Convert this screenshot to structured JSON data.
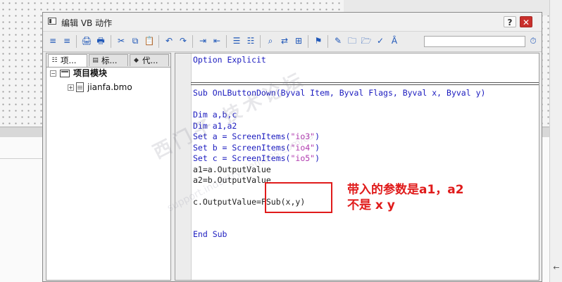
{
  "window": {
    "title": "编辑 VB 动作",
    "help_label": "?",
    "close_label": "✕"
  },
  "toolbar": {
    "icons": [
      "align-left-icon",
      "align-right-icon",
      "print-icon",
      "print-preview-icon",
      "cut-icon",
      "copy-icon",
      "paste-icon",
      "undo-icon",
      "redo-icon",
      "indent-icon",
      "outdent-icon",
      "comment-icon",
      "uncomment-icon",
      "find-icon",
      "replace-icon",
      "bookmark-icon",
      "syntax-check-icon",
      "new-item-icon",
      "folder-icon",
      "folder-add-icon",
      "tag-icon",
      "compile-icon",
      "clock-icon"
    ],
    "glyphs": [
      "≡",
      "≡",
      "🖨",
      "🖶",
      "✂",
      "⧉",
      "📋",
      "↶",
      "↷",
      "⇥",
      "⇤",
      "☰",
      "☷",
      "⌕",
      "⇄",
      "⊞",
      "⚑",
      "✎",
      "🗀",
      "🗁",
      "✓",
      "Ȃ",
      "⏱"
    ]
  },
  "left_panel": {
    "tabs": [
      {
        "label": "项...",
        "icon": "tree-icon"
      },
      {
        "label": "标...",
        "icon": "tag-icon"
      },
      {
        "label": "代...",
        "icon": "code-icon"
      }
    ],
    "tree": {
      "root_label": "项目模块",
      "root_expander": "−",
      "child_label": "jianfa.bmo",
      "child_expander": "+"
    }
  },
  "editor": {
    "lines": [
      "Option Explicit",
      "Sub OnLButtonDown(Byval Item, Byval Flags, Byval x, Byval y)",
      "Dim a,b,c",
      "Dim a1,a2",
      "Set a = ScreenItems(\"io3\")",
      "Set b = ScreenItems(\"io4\")",
      "Set c = ScreenItems(\"io5\")",
      "a1=a.OutputValue",
      "a2=b.OutputValue",
      "c.OutputValue=FSub(x,y)",
      "End Sub"
    ],
    "string_parts": {
      "l4_pre": "Set a = ScreenItems(",
      "l4_str": "\"io3\"",
      "l4_post": ")",
      "l5_pre": "Set b = ScreenItems(",
      "l5_str": "\"io4\"",
      "l5_post": ")",
      "l6_pre": "Set c = ScreenItems(",
      "l6_str": "\"io5\"",
      "l6_post": ")"
    }
  },
  "annotation": {
    "line1": "带入的参数是a1，a2",
    "line2": "不是 x y"
  },
  "watermark": {
    "main": "西门子 技术论坛",
    "sub": "support.industry.siemens.com/cs"
  },
  "colors": {
    "keyword": "#1b1bbf",
    "string": "#b03aaf",
    "annotation": "#e01b1b",
    "close_button": "#c9302c"
  }
}
